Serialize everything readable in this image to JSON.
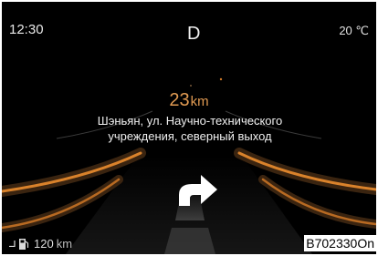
{
  "status_bar": {
    "time": "12:30",
    "gear": "D",
    "temperature": "20 ℃"
  },
  "navigation": {
    "distance_value": "23",
    "distance_unit": "km",
    "street_line1": "Шэньян, ул. Научно-технического",
    "street_line2": "учреждения, северный выход",
    "maneuver_icon": "turn-right-arrow-icon"
  },
  "fuel": {
    "icon": "fuel-pump-icon",
    "range_value": "120",
    "range_unit": "km"
  },
  "image_reference": "B702330On",
  "colors": {
    "background": "#000000",
    "distance_accent": "#e09a52",
    "road_edge": "#d9822b",
    "text": "#f0f0f0"
  }
}
